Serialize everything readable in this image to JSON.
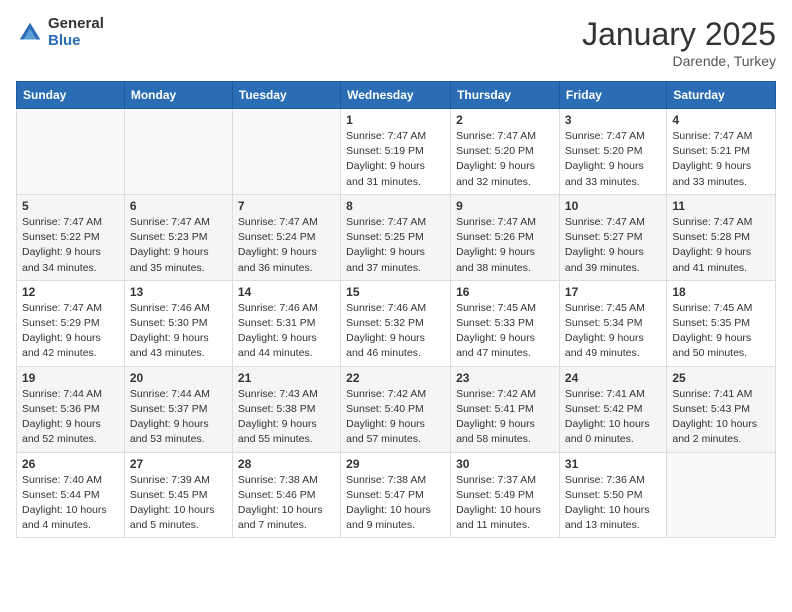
{
  "header": {
    "logo_general": "General",
    "logo_blue": "Blue",
    "title": "January 2025",
    "location": "Darende, Turkey"
  },
  "weekdays": [
    "Sunday",
    "Monday",
    "Tuesday",
    "Wednesday",
    "Thursday",
    "Friday",
    "Saturday"
  ],
  "weeks": [
    [
      {
        "day": "",
        "info": ""
      },
      {
        "day": "",
        "info": ""
      },
      {
        "day": "",
        "info": ""
      },
      {
        "day": "1",
        "info": "Sunrise: 7:47 AM\nSunset: 5:19 PM\nDaylight: 9 hours\nand 31 minutes."
      },
      {
        "day": "2",
        "info": "Sunrise: 7:47 AM\nSunset: 5:20 PM\nDaylight: 9 hours\nand 32 minutes."
      },
      {
        "day": "3",
        "info": "Sunrise: 7:47 AM\nSunset: 5:20 PM\nDaylight: 9 hours\nand 33 minutes."
      },
      {
        "day": "4",
        "info": "Sunrise: 7:47 AM\nSunset: 5:21 PM\nDaylight: 9 hours\nand 33 minutes."
      }
    ],
    [
      {
        "day": "5",
        "info": "Sunrise: 7:47 AM\nSunset: 5:22 PM\nDaylight: 9 hours\nand 34 minutes."
      },
      {
        "day": "6",
        "info": "Sunrise: 7:47 AM\nSunset: 5:23 PM\nDaylight: 9 hours\nand 35 minutes."
      },
      {
        "day": "7",
        "info": "Sunrise: 7:47 AM\nSunset: 5:24 PM\nDaylight: 9 hours\nand 36 minutes."
      },
      {
        "day": "8",
        "info": "Sunrise: 7:47 AM\nSunset: 5:25 PM\nDaylight: 9 hours\nand 37 minutes."
      },
      {
        "day": "9",
        "info": "Sunrise: 7:47 AM\nSunset: 5:26 PM\nDaylight: 9 hours\nand 38 minutes."
      },
      {
        "day": "10",
        "info": "Sunrise: 7:47 AM\nSunset: 5:27 PM\nDaylight: 9 hours\nand 39 minutes."
      },
      {
        "day": "11",
        "info": "Sunrise: 7:47 AM\nSunset: 5:28 PM\nDaylight: 9 hours\nand 41 minutes."
      }
    ],
    [
      {
        "day": "12",
        "info": "Sunrise: 7:47 AM\nSunset: 5:29 PM\nDaylight: 9 hours\nand 42 minutes."
      },
      {
        "day": "13",
        "info": "Sunrise: 7:46 AM\nSunset: 5:30 PM\nDaylight: 9 hours\nand 43 minutes."
      },
      {
        "day": "14",
        "info": "Sunrise: 7:46 AM\nSunset: 5:31 PM\nDaylight: 9 hours\nand 44 minutes."
      },
      {
        "day": "15",
        "info": "Sunrise: 7:46 AM\nSunset: 5:32 PM\nDaylight: 9 hours\nand 46 minutes."
      },
      {
        "day": "16",
        "info": "Sunrise: 7:45 AM\nSunset: 5:33 PM\nDaylight: 9 hours\nand 47 minutes."
      },
      {
        "day": "17",
        "info": "Sunrise: 7:45 AM\nSunset: 5:34 PM\nDaylight: 9 hours\nand 49 minutes."
      },
      {
        "day": "18",
        "info": "Sunrise: 7:45 AM\nSunset: 5:35 PM\nDaylight: 9 hours\nand 50 minutes."
      }
    ],
    [
      {
        "day": "19",
        "info": "Sunrise: 7:44 AM\nSunset: 5:36 PM\nDaylight: 9 hours\nand 52 minutes."
      },
      {
        "day": "20",
        "info": "Sunrise: 7:44 AM\nSunset: 5:37 PM\nDaylight: 9 hours\nand 53 minutes."
      },
      {
        "day": "21",
        "info": "Sunrise: 7:43 AM\nSunset: 5:38 PM\nDaylight: 9 hours\nand 55 minutes."
      },
      {
        "day": "22",
        "info": "Sunrise: 7:42 AM\nSunset: 5:40 PM\nDaylight: 9 hours\nand 57 minutes."
      },
      {
        "day": "23",
        "info": "Sunrise: 7:42 AM\nSunset: 5:41 PM\nDaylight: 9 hours\nand 58 minutes."
      },
      {
        "day": "24",
        "info": "Sunrise: 7:41 AM\nSunset: 5:42 PM\nDaylight: 10 hours\nand 0 minutes."
      },
      {
        "day": "25",
        "info": "Sunrise: 7:41 AM\nSunset: 5:43 PM\nDaylight: 10 hours\nand 2 minutes."
      }
    ],
    [
      {
        "day": "26",
        "info": "Sunrise: 7:40 AM\nSunset: 5:44 PM\nDaylight: 10 hours\nand 4 minutes."
      },
      {
        "day": "27",
        "info": "Sunrise: 7:39 AM\nSunset: 5:45 PM\nDaylight: 10 hours\nand 5 minutes."
      },
      {
        "day": "28",
        "info": "Sunrise: 7:38 AM\nSunset: 5:46 PM\nDaylight: 10 hours\nand 7 minutes."
      },
      {
        "day": "29",
        "info": "Sunrise: 7:38 AM\nSunset: 5:47 PM\nDaylight: 10 hours\nand 9 minutes."
      },
      {
        "day": "30",
        "info": "Sunrise: 7:37 AM\nSunset: 5:49 PM\nDaylight: 10 hours\nand 11 minutes."
      },
      {
        "day": "31",
        "info": "Sunrise: 7:36 AM\nSunset: 5:50 PM\nDaylight: 10 hours\nand 13 minutes."
      },
      {
        "day": "",
        "info": ""
      }
    ]
  ]
}
